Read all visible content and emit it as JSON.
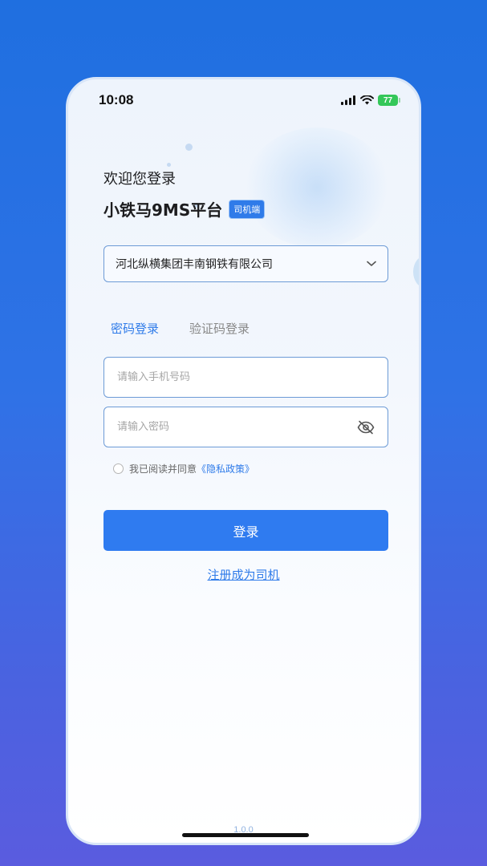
{
  "status_bar": {
    "time": "10:08",
    "battery": "77"
  },
  "header": {
    "welcome": "欢迎您登录",
    "app_title": "小铁马9MS平台",
    "role_tag": "司机端"
  },
  "company_select": {
    "value": "河北纵横集团丰南钢铁有限公司"
  },
  "tabs": [
    {
      "label": "密码登录",
      "active": true
    },
    {
      "label": "验证码登录",
      "active": false
    }
  ],
  "form": {
    "phone_placeholder": "请输入手机号码",
    "password_placeholder": "请输入密码",
    "agree_prefix": "我已阅读并同意",
    "policy_link": "《隐私政策》"
  },
  "buttons": {
    "login": "登录",
    "register": "注册成为司机"
  },
  "footer": {
    "version": "1.0.0"
  },
  "colors": {
    "accent": "#2f7be9",
    "background_top": "#1f6fe0",
    "background_bottom": "#5a5cdf"
  }
}
